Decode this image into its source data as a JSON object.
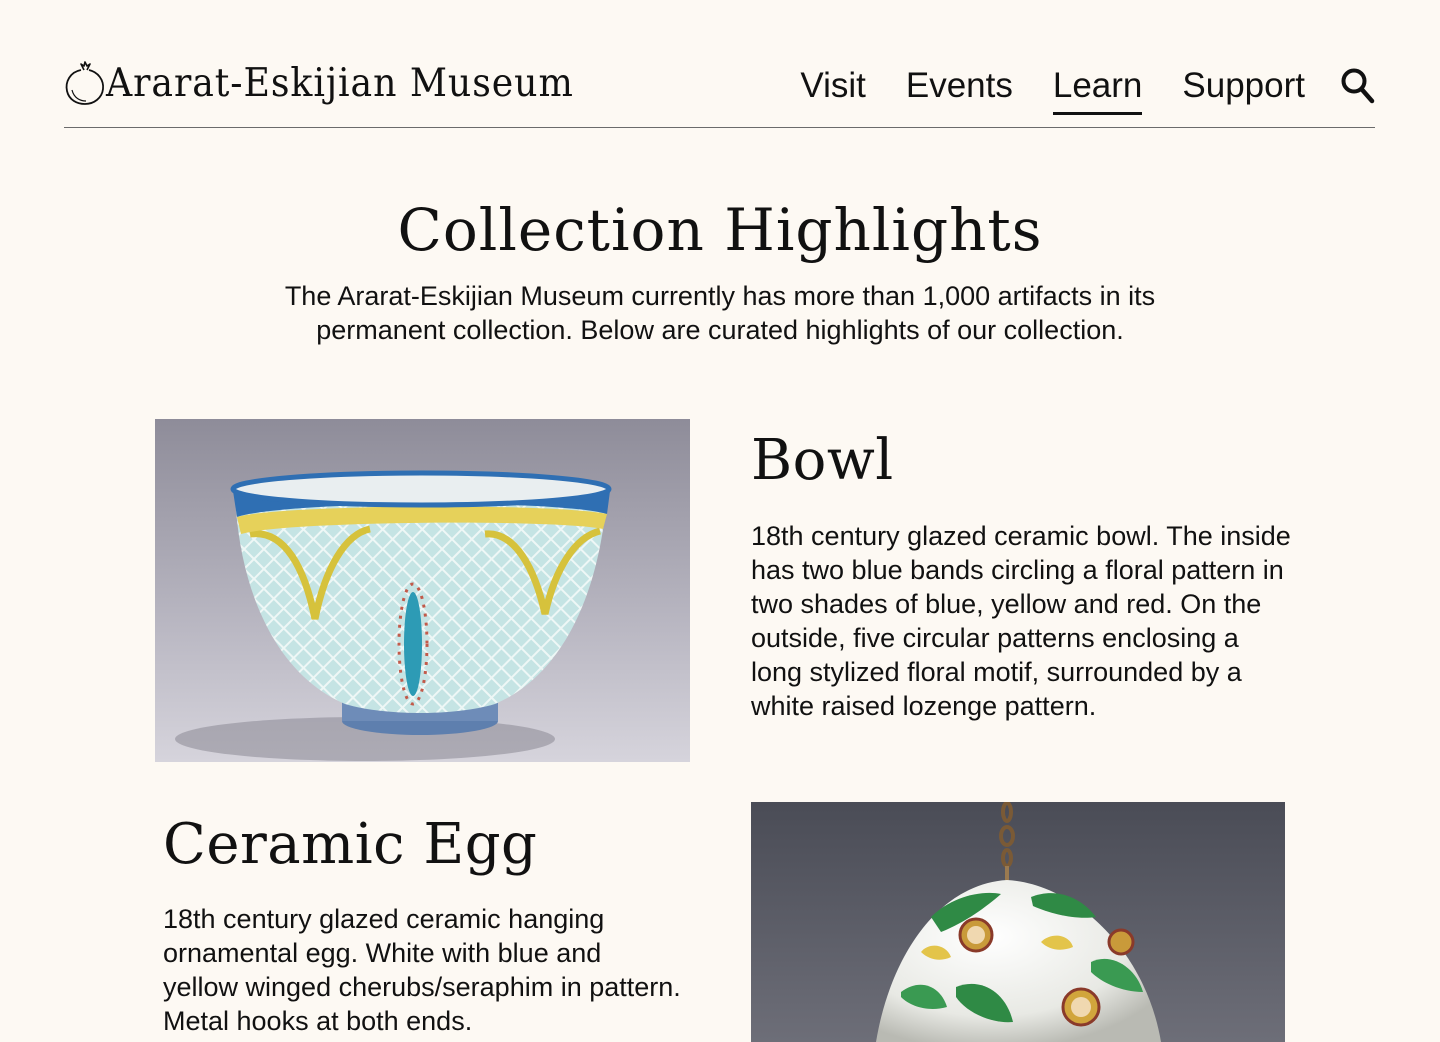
{
  "header": {
    "museum_name": "Ararat-Eskijian Museum",
    "nav": [
      {
        "label": "Visit",
        "active": false
      },
      {
        "label": "Events",
        "active": false
      },
      {
        "label": "Learn",
        "active": true
      },
      {
        "label": "Support",
        "active": false
      }
    ],
    "icons": {
      "logo": "pomegranate-icon",
      "search": "search-icon"
    }
  },
  "main": {
    "title": "Collection Highlights",
    "intro": "The Ararat-Eskijian Museum currently has more than 1,000 artifacts in its permanent collection. Below are curated highlights of our collection.",
    "items": [
      {
        "title": "Bowl",
        "description": "18th century glazed ceramic bowl. The inside has two blue bands circling a floral pattern in two shades of blue, yellow and red. On the outside, five circular patterns enclosing a long stylized floral motif, surrounded by a white raised lozenge pattern."
      },
      {
        "title": "Ceramic Egg",
        "description": "18th century glazed ceramic hanging ornamental egg. White with blue and yellow winged cherubs/seraphim in pattern. Metal hooks at both ends."
      }
    ]
  },
  "colors": {
    "background": "#fdf9f3",
    "text": "#111111",
    "rule": "#6b6b6b"
  }
}
